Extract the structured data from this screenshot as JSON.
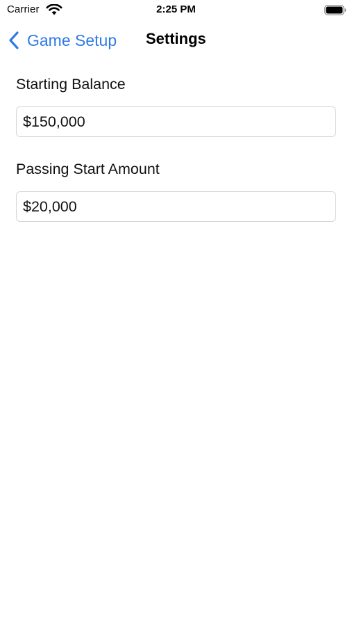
{
  "status_bar": {
    "carrier": "Carrier",
    "time": "2:25 PM",
    "wifi_icon": "wifi-icon",
    "battery_icon": "battery-icon"
  },
  "nav": {
    "back_label": "Game Setup",
    "back_icon": "chevron-left-icon",
    "title": "Settings",
    "accent_color": "#2f7ae5"
  },
  "form": {
    "starting_balance": {
      "label": "Starting Balance",
      "value": "$150,000"
    },
    "passing_start_amount": {
      "label": "Passing Start Amount",
      "value": "$20,000"
    }
  }
}
